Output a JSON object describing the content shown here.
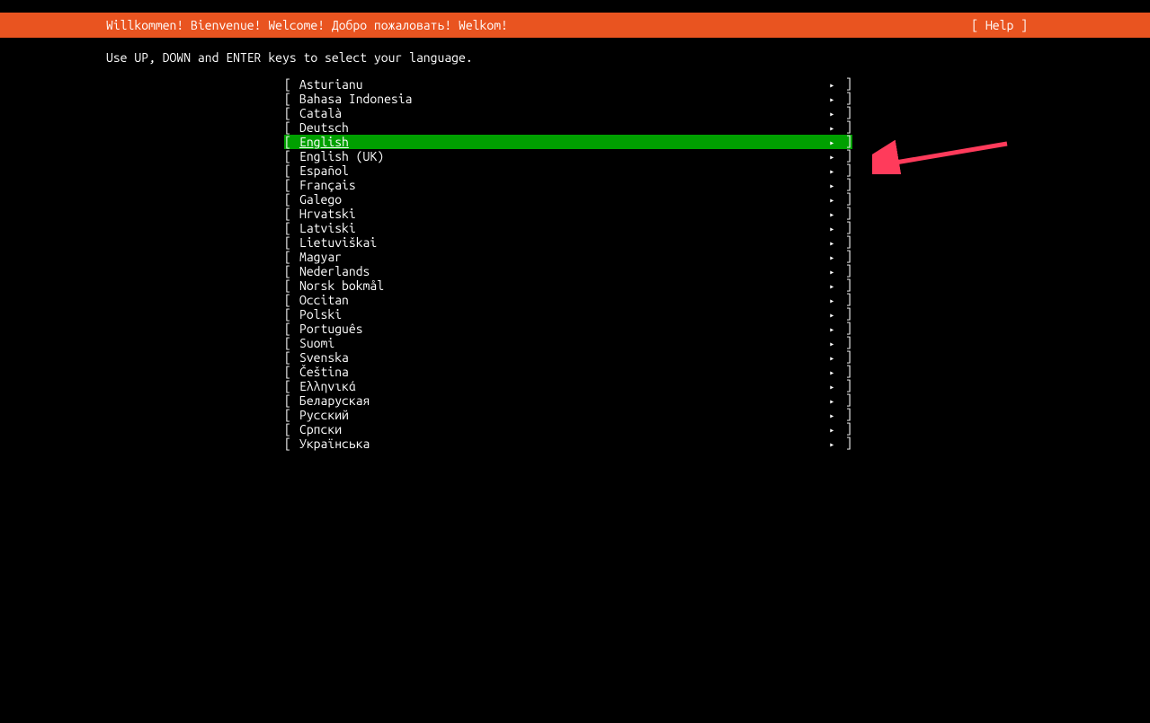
{
  "header": {
    "title": "Willkommen! Bienvenue! Welcome! Добро пожаловать! Welkom!",
    "help": "[ Help ]"
  },
  "instruction": "Use UP, DOWN and ENTER keys to select your language.",
  "languages": [
    {
      "label": "Asturianu",
      "selected": false
    },
    {
      "label": "Bahasa Indonesia",
      "selected": false
    },
    {
      "label": "Català",
      "selected": false
    },
    {
      "label": "Deutsch",
      "selected": false
    },
    {
      "label": "English",
      "selected": true
    },
    {
      "label": "English (UK)",
      "selected": false
    },
    {
      "label": "Español",
      "selected": false
    },
    {
      "label": "Français",
      "selected": false
    },
    {
      "label": "Galego",
      "selected": false
    },
    {
      "label": "Hrvatski",
      "selected": false
    },
    {
      "label": "Latviski",
      "selected": false
    },
    {
      "label": "Lietuviškai",
      "selected": false
    },
    {
      "label": "Magyar",
      "selected": false
    },
    {
      "label": "Nederlands",
      "selected": false
    },
    {
      "label": "Norsk bokmål",
      "selected": false
    },
    {
      "label": "Occitan",
      "selected": false
    },
    {
      "label": "Polski",
      "selected": false
    },
    {
      "label": "Português",
      "selected": false
    },
    {
      "label": "Suomi",
      "selected": false
    },
    {
      "label": "Svenska",
      "selected": false
    },
    {
      "label": "Čeština",
      "selected": false
    },
    {
      "label": "Ελληνικά",
      "selected": false
    },
    {
      "label": "Беларуская",
      "selected": false
    },
    {
      "label": "Русский",
      "selected": false
    },
    {
      "label": "Српски",
      "selected": false
    },
    {
      "label": "Українська",
      "selected": false
    }
  ],
  "brackets": {
    "open": "[ ",
    "close": " ]",
    "arrow": "▸"
  }
}
